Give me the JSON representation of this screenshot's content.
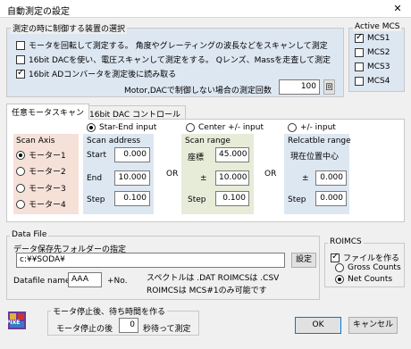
{
  "window": {
    "title": "自動測定の設定",
    "close_label": "✕"
  },
  "measure_group": {
    "title": "測定の時に制御する装置の選択",
    "options": [
      {
        "label": "モータを回転して測定する。 角度やグレーティングの波長などをスキャンして測定",
        "checked": false
      },
      {
        "label": "16bit DACを使い、電圧スキャンして測定をする。 Qレンズ、Massを走査して測定",
        "checked": false
      },
      {
        "label": "16bit ADコンバータを測定後に読み取る",
        "checked": true
      }
    ],
    "limit_label": "Motor,DACで制御しない場合の測定回数",
    "limit_value": "100",
    "spin_label": "回"
  },
  "active_mcs": {
    "title": "Active MCS",
    "items": [
      {
        "label": "MCS1",
        "checked": true
      },
      {
        "label": "MCS2",
        "checked": false
      },
      {
        "label": "MCS3",
        "checked": false
      },
      {
        "label": "MCS4",
        "checked": false
      }
    ]
  },
  "tabs": [
    {
      "label": "任意モータスキャン",
      "active": true
    },
    {
      "label": "16bit DAC コントロール",
      "active": false
    }
  ],
  "scan_axis": {
    "title": "Scan Axis",
    "items": [
      {
        "label": "モーター1",
        "checked": true
      },
      {
        "label": "モーター2",
        "checked": false
      },
      {
        "label": "モーター3",
        "checked": false
      },
      {
        "label": "モーター4",
        "checked": false
      }
    ]
  },
  "mode_radios": [
    {
      "label": "Star-End input",
      "checked": true
    },
    {
      "label": "Center +/- input",
      "checked": false
    },
    {
      "label": "+/- input",
      "checked": false
    }
  ],
  "scan_address": {
    "title": "Scan address",
    "rows": [
      {
        "label": "Start",
        "value": "0.000"
      },
      {
        "label": "End",
        "value": "10.000"
      },
      {
        "label": "Step",
        "value": "0.100"
      }
    ]
  },
  "or_label": "OR",
  "scan_range": {
    "title": "Scan range",
    "rows": [
      {
        "label": "座標",
        "value": "45.000"
      },
      {
        "label": "±",
        "value": "10.000"
      },
      {
        "label": "Step",
        "value": "0.100"
      }
    ]
  },
  "relcatable_range": {
    "title": "Relcatble range",
    "center_label": "現在位置中心",
    "rows": [
      {
        "label": "±",
        "value": "0.000"
      },
      {
        "label": "Step",
        "value": "0.000"
      }
    ]
  },
  "data_file": {
    "title": "Data File",
    "folder_label": "データ保存先フォルダーの指定",
    "folder_value": "c:¥¥SODA¥",
    "settings_button": "設定",
    "datafile_label": "Datafile name:",
    "datafile_value": "AAA",
    "no_label": "+No.",
    "note_line1": "スペクトルは .DAT   ROIMCSは .CSV",
    "note_line2": "ROIMCSは MCS#1のみ可能です"
  },
  "roimcs": {
    "title": "ROIMCS",
    "make_file_label": "ファイルを作る",
    "make_file_checked": true,
    "options": [
      {
        "label": "Gross Counts",
        "checked": false
      },
      {
        "label": "Net    Counts",
        "checked": true
      }
    ]
  },
  "wait_group": {
    "title": "モータ停止後、待ち時間を作る",
    "before": "モータ停止の後",
    "value": "0",
    "after": "秒待って測定"
  },
  "buttons": {
    "ok": "OK",
    "cancel": "キャンセル"
  },
  "app_icon": {
    "label": "PIXE"
  }
}
